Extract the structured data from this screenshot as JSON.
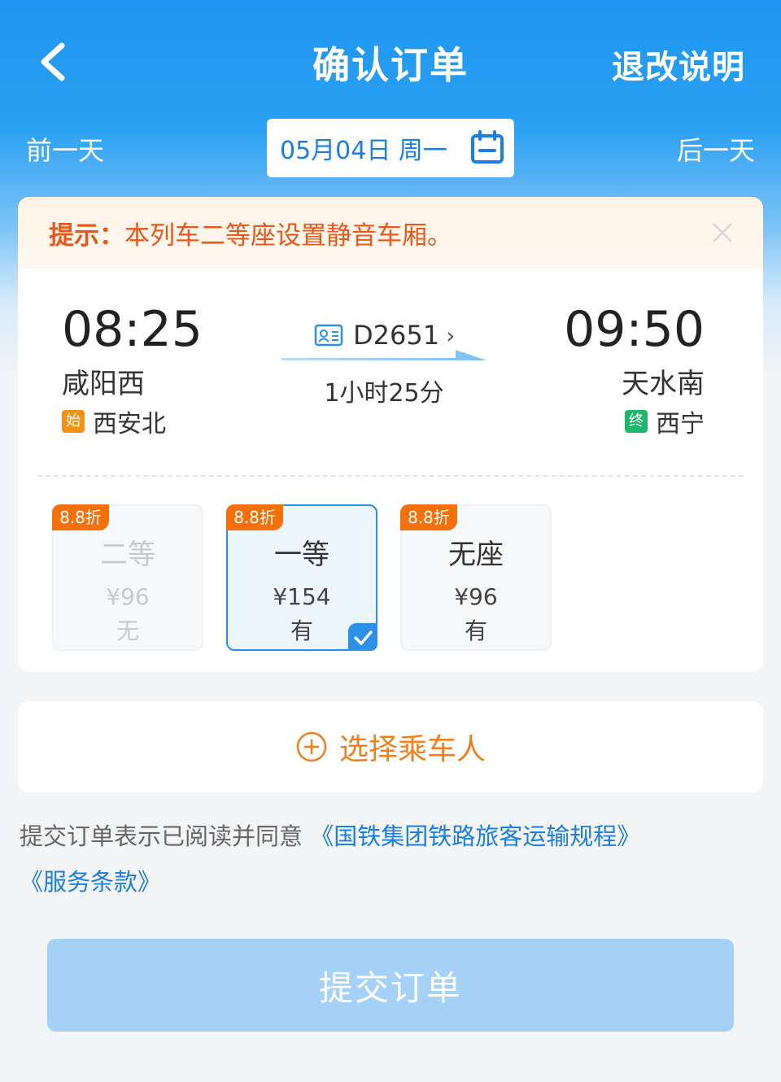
{
  "header": {
    "title": "确认订单",
    "refund_label": "退改说明"
  },
  "date_nav": {
    "prev_label": "前一天",
    "next_label": "后一天",
    "date_label": "05月04日 周一"
  },
  "notice": {
    "prefix": "提示：",
    "text": "本列车二等座设置静音车厢。"
  },
  "trip": {
    "departure": {
      "time": "08:25",
      "station": "咸阳西",
      "origin_tag": "始",
      "origin": "西安北"
    },
    "arrival": {
      "time": "09:50",
      "station": "天水南",
      "terminal_tag": "终",
      "terminal": "西宁"
    },
    "train_no": "D2651",
    "duration": "1小时25分"
  },
  "seats": [
    {
      "discount": "8.8折",
      "name": "二等",
      "price": "¥96",
      "availability": "无"
    },
    {
      "discount": "8.8折",
      "name": "一等",
      "price": "¥154",
      "availability": "有"
    },
    {
      "discount": "8.8折",
      "name": "无座",
      "price": "¥96",
      "availability": "有"
    }
  ],
  "passenger": {
    "label": "选择乘车人"
  },
  "terms": {
    "prefix": "提交订单表示已阅读并同意",
    "link1": "《国铁集团铁路旅客运输规程》",
    "link2": "《服务条款》"
  },
  "submit": {
    "label": "提交订单"
  },
  "colors": {
    "brand_blue": "#1e96f0",
    "notice_orange": "#e55a1c",
    "discount_orange": "#f5700a",
    "submit_disabled": "#a6d1f6"
  }
}
